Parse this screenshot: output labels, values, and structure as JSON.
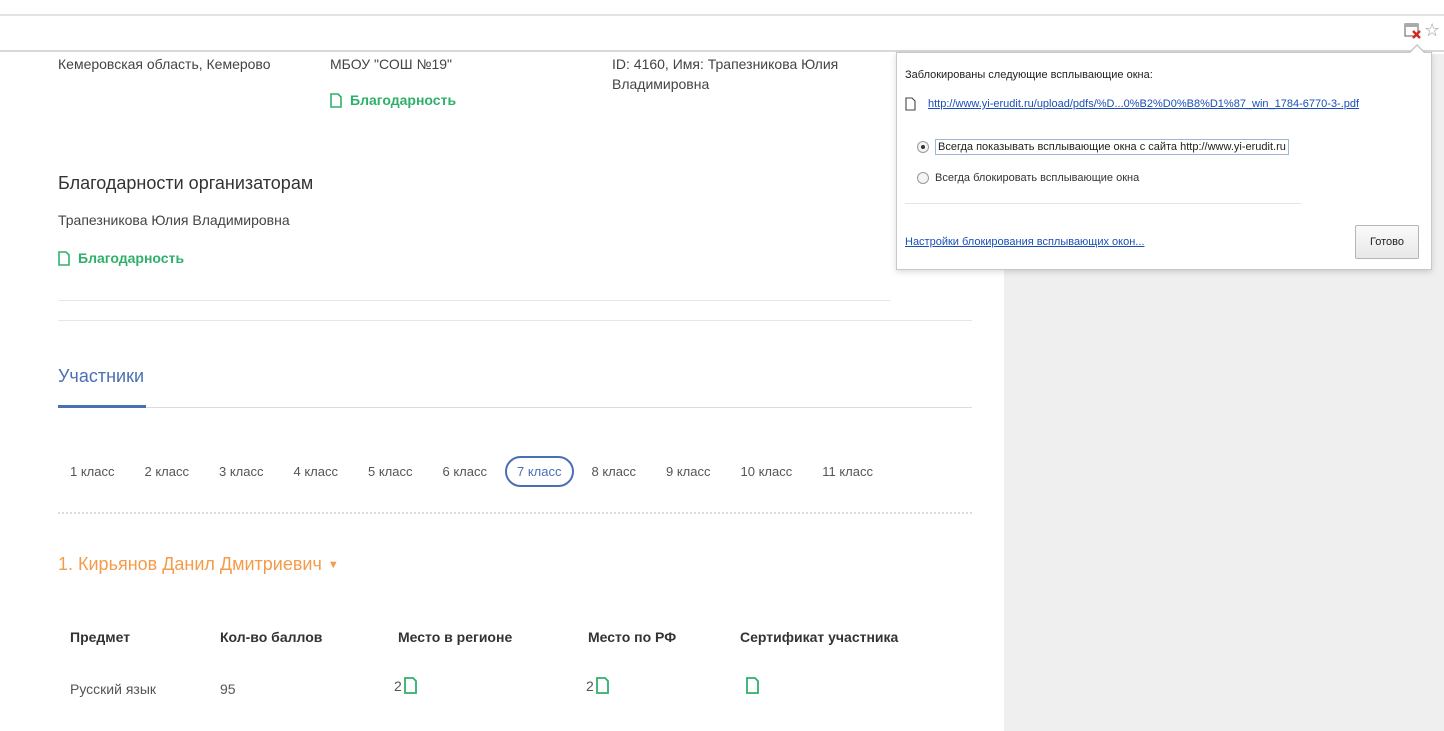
{
  "colors": {
    "accent": "#4a6fb5",
    "green": "#2fb06a",
    "orange": "#f39c4a",
    "link": "#1a4fb8"
  },
  "top_block": {
    "region": "Кемеровская область, Кемерово",
    "school": "МБОУ \"СОШ №19\"",
    "id_line": "ID: 4160, Имя: Трапезникова Юлия",
    "id_line2": "Владимировна",
    "gratitude": "Благодарность"
  },
  "organizers": {
    "title": "Благодарности организаторам",
    "name": "Трапезникова Юлия Владимировна",
    "gratitude": "Благодарность"
  },
  "tabs": {
    "participants": "Участники"
  },
  "classes": [
    "1 класс",
    "2 класс",
    "3 класс",
    "4 класс",
    "5 класс",
    "6 класс",
    "7 класс",
    "8 класс",
    "9 класс",
    "10 класс",
    "11 класс"
  ],
  "active_class": "7 класс",
  "participant": {
    "name": "1. Кирьянов Данил Дмитриевич"
  },
  "table": {
    "headers": [
      "Предмет",
      "Кол-во баллов",
      "Место в регионе",
      "Место по РФ",
      "Сертификат участника"
    ],
    "rows": [
      {
        "subject": "Русский язык",
        "score": "95",
        "region_place": "2",
        "rf_place": "2"
      }
    ]
  },
  "popup": {
    "title": "Заблокированы следующие всплывающие окна:",
    "link": "http://www.yi-erudit.ru/upload/pdfs/%D...0%B2%D0%B8%D1%87_win_1784-6770-3-.pdf",
    "option_allow": "Всегда показывать всплывающие окна с сайта http://www.yi-erudit.ru",
    "option_block": "Всегда блокировать всплывающие окна",
    "settings_link": "Настройки блокирования всплывающих окон...",
    "done": "Готово"
  },
  "icons": {
    "doc": "document-icon",
    "popup_blocked": "popup-blocked-icon",
    "star": "bookmark-star-icon"
  }
}
